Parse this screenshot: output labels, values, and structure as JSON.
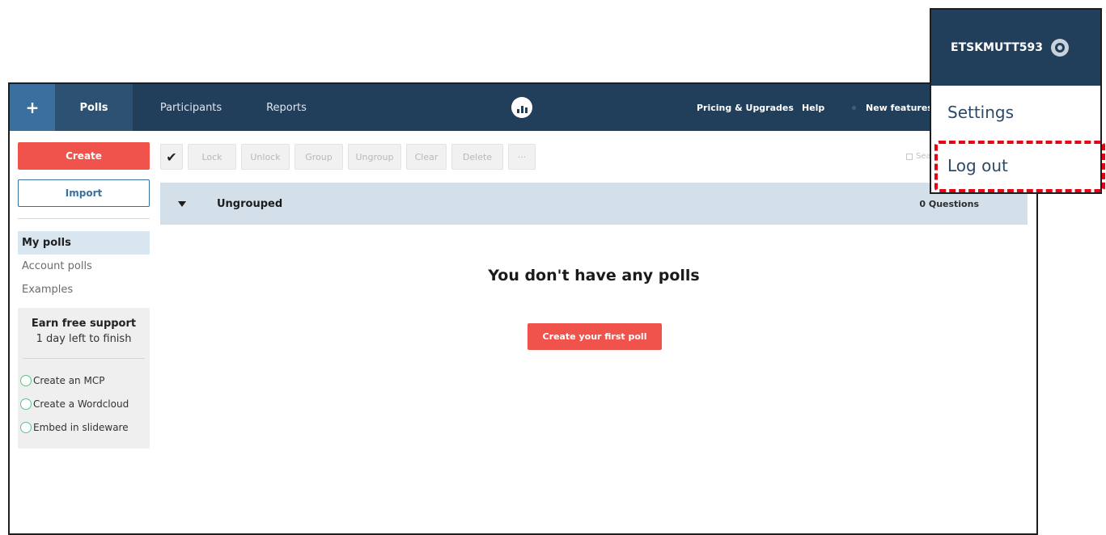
{
  "nav": {
    "plus": "+",
    "tabs": [
      "Polls",
      "Participants",
      "Reports"
    ],
    "right_items": [
      "Pricing & Upgrades",
      "Help",
      "New features"
    ]
  },
  "sidebar": {
    "create_label": "Create",
    "import_label": "Import",
    "items": [
      "My polls",
      "Account polls",
      "Examples"
    ],
    "support_title": "Earn free support",
    "support_sub": "1 day left to finish",
    "tasks": [
      "Create an MCP",
      "Create a Wordcloud",
      "Embed in slideware"
    ]
  },
  "toolbar": {
    "check": "✔",
    "buttons": [
      "Lock",
      "Unlock",
      "Group",
      "Ungroup",
      "Clear",
      "Delete",
      "···"
    ],
    "search_hint": "Sea"
  },
  "group": {
    "title": "Ungrouped",
    "count": "0 Questions"
  },
  "empty": {
    "title": "You don't have any polls",
    "cta": "Create your first poll"
  },
  "user_menu": {
    "username": "ETSKMUTT593",
    "items": [
      "Settings",
      "Log out"
    ]
  },
  "colors": {
    "nav": "#213e5b",
    "accent": "#f0534b",
    "highlight": "#e60012"
  }
}
